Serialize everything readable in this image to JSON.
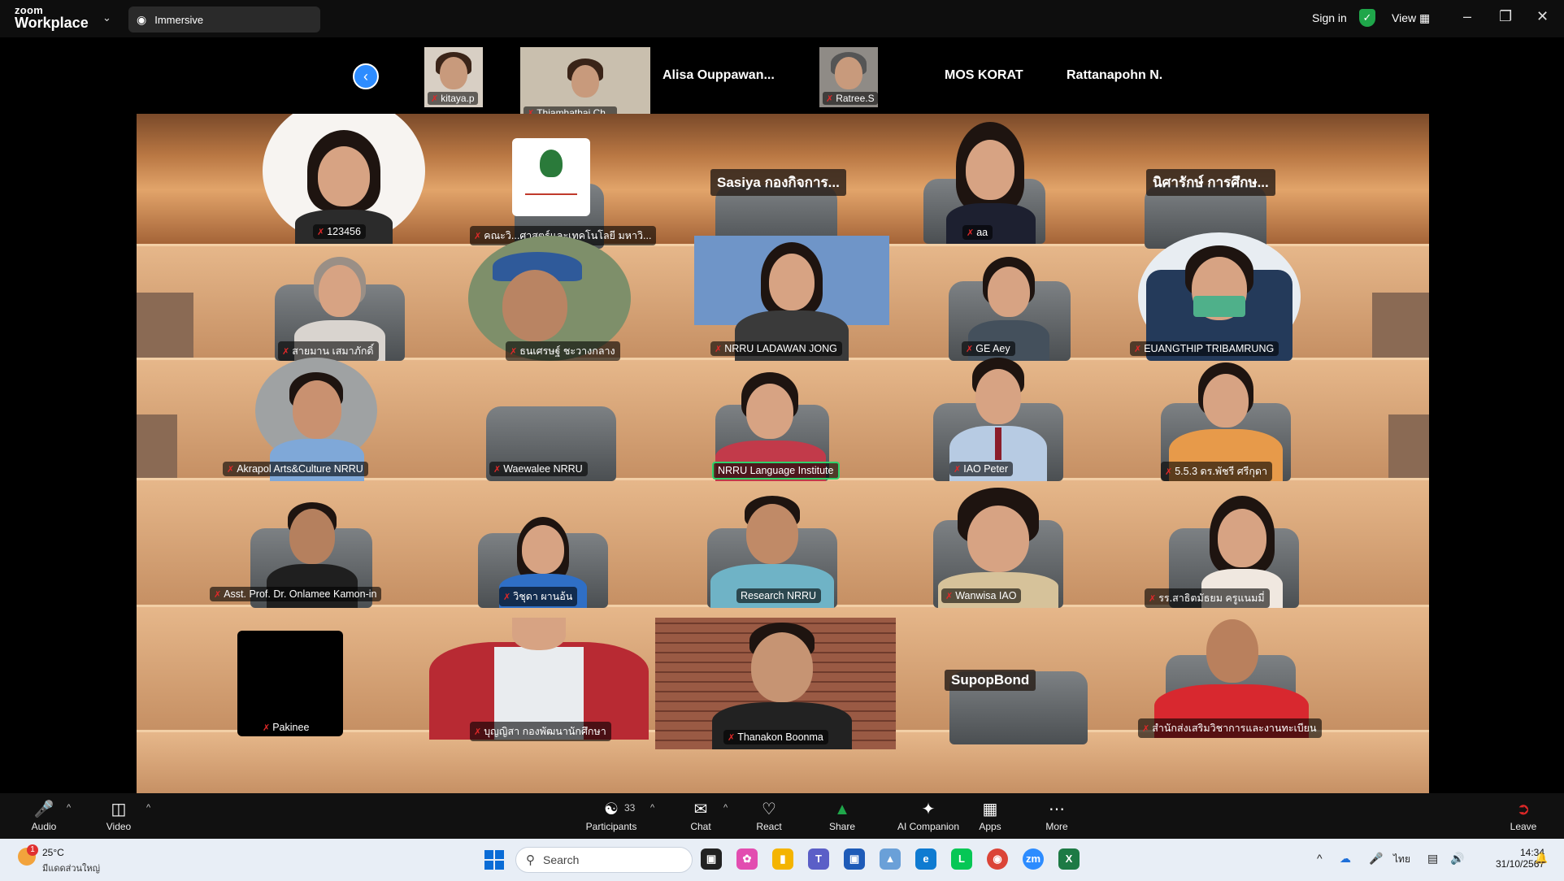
{
  "app": {
    "logo_small": "zoom",
    "logo_big": "Workplace",
    "view_mode": "Immersive",
    "sign_in": "Sign in",
    "view": "View"
  },
  "strip": {
    "thumbs": [
      "kitaya.p",
      "Thiamhathai Ch...",
      "Ratree.S"
    ],
    "names": [
      "Alisa  Ouppawan...",
      "MOS KORAT",
      "Rattanapohn N."
    ]
  },
  "participants": {
    "row1": [
      "123456",
      "คณะวิ...ศาสตร์และเทคโนโลยี มหาวิ...",
      "aa"
    ],
    "row1_cards": [
      "Sasiya กองกิจการ...",
      "นิศารักษ์ การศึกษ..."
    ],
    "row2": [
      "สายมาน เสมาภักดิ์",
      "ธนเศรษฐ์ ชะวางกลาง",
      "NRRU LADAWAN JONG",
      "GE Aey",
      "EUANGTHIP TRIBAMRUNG"
    ],
    "row3": [
      "Akrapol Arts&Culture NRRU",
      "Waewalee NRRU",
      "NRRU Language Institute",
      "IAO Peter",
      "5.5.3 ดร.พัชรี ศรีกุดา"
    ],
    "row4": [
      "Asst. Prof. Dr. Onlamee Kamon-in",
      "วิชุดา ผานอ้น",
      "Research NRRU",
      "Wanwisa IAO",
      "รร.สาธิตมัธยม ครูแนมมี่"
    ],
    "row5": [
      "Pakinee",
      "บุญญิสา กองพัฒนานักศึกษา",
      "Thanakon Boonma",
      "สำนักส่งเสริมวิชาการและงานทะเบียน"
    ],
    "row5_card": "SupopBond"
  },
  "controls": {
    "audio": "Audio",
    "video": "Video",
    "participants": "Participants",
    "participants_count": "33",
    "chat": "Chat",
    "react": "React",
    "share": "Share",
    "ai": "AI Companion",
    "apps": "Apps",
    "more": "More",
    "leave": "Leave"
  },
  "taskbar": {
    "temp": "25°C",
    "location": "มีแดดส่วนใหญ่",
    "weather_badge": "1",
    "search": "Search",
    "lang": "ไทย",
    "time": "14:34",
    "date": "31/10/2567"
  },
  "colors": {
    "zoom_blue": "#2d8cff",
    "share_green": "#1fa64a",
    "mic_off_red": "#e02828",
    "speaking_green": "#2fd26b"
  }
}
